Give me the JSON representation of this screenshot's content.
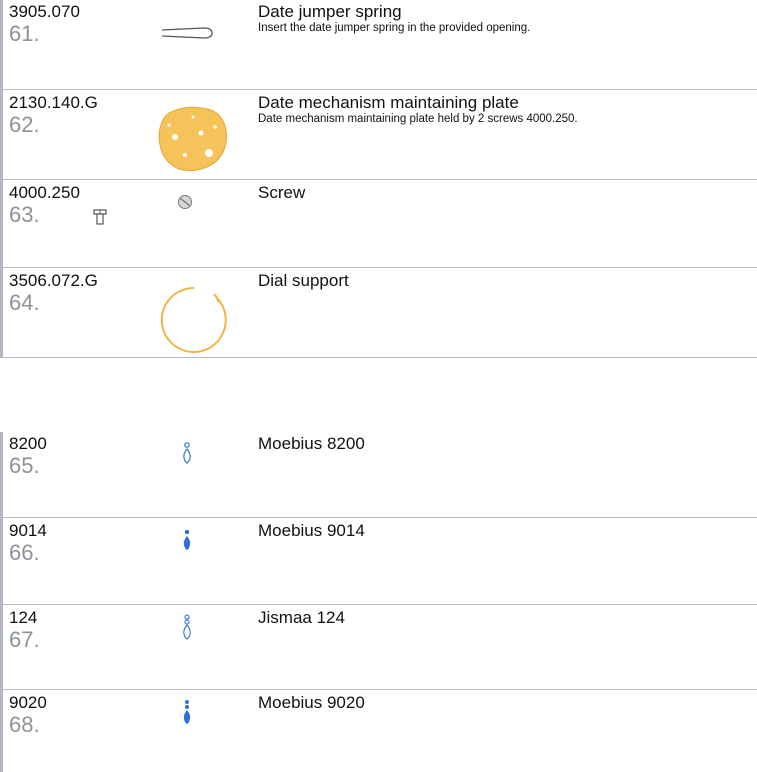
{
  "parts": [
    {
      "ref": "3905.070",
      "number": "61.",
      "title": "Date jumper spring",
      "description": "Insert the date jumper spring in the provided opening.",
      "icon": "spring-icon"
    },
    {
      "ref": "2130.140.G",
      "number": "62.",
      "title": "Date mechanism maintaining plate",
      "description": "Date mechanism maintaining plate held by 2 screws 4000.250.",
      "icon": "plate-icon"
    },
    {
      "ref": "4000.250",
      "number": "63.",
      "title": "Screw",
      "description": "",
      "icon": "screw-icon"
    },
    {
      "ref": "3506.072.G",
      "number": "64.",
      "title": "Dial support",
      "description": "",
      "icon": "ring-icon"
    }
  ],
  "oils": [
    {
      "ref": "8200",
      "number": "65.",
      "title": "Moebius 8200",
      "icon": "oiler-outline-icon",
      "color": "#2d6fd6"
    },
    {
      "ref": "9014",
      "number": "66.",
      "title": "Moebius 9014",
      "icon": "oiler-filled-icon",
      "color": "#2d6fd6"
    },
    {
      "ref": "124",
      "number": "67.",
      "title": "Jismaa 124",
      "icon": "oiler-outline-icon",
      "color": "#2d6fd6"
    },
    {
      "ref": "9020",
      "number": "68.",
      "title": "Moebius 9020",
      "icon": "oiler-filled-icon",
      "color": "#2d6fd6"
    }
  ],
  "colors": {
    "gold": "#f6c35a",
    "gold_dark": "#e2a63a",
    "oil_blue": "#2d6fd6",
    "separator": "#b8bcc2"
  }
}
